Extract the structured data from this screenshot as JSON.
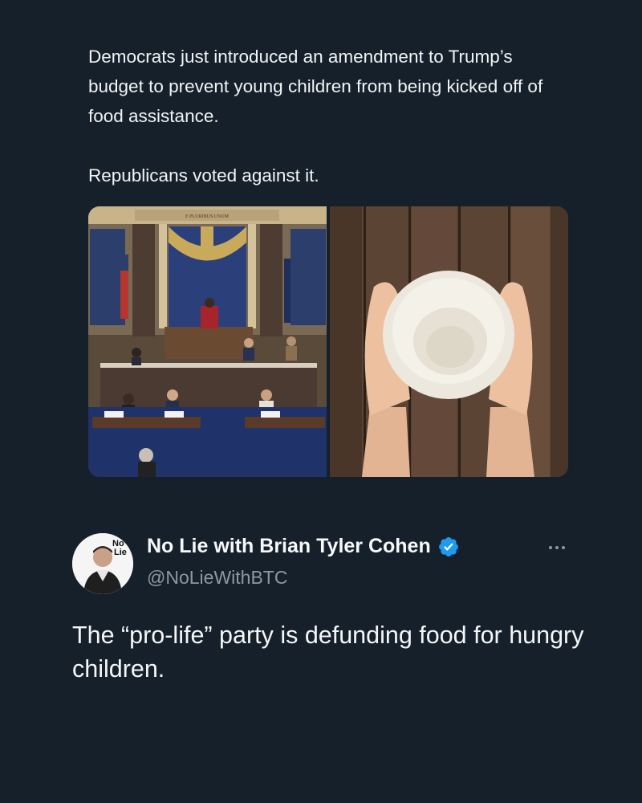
{
  "quoted": {
    "paragraph1": "Democrats just introduced an amendment to Trump’s budget to prevent young children from being kicked off of food assistance.",
    "paragraph2": "Republicans voted against it."
  },
  "media": {
    "left_banner": "E PLURIBUS UNUM"
  },
  "author": {
    "name": "No Lie with Brian Tyler Cohen",
    "handle": "@NoLieWithBTC",
    "avatar_text_1": "No",
    "avatar_text_2": "Lie"
  },
  "tweet": {
    "text": "The “pro-life” party is defunding food for hungry children."
  },
  "colors": {
    "background": "#15202b",
    "verified": "#1d9bf0",
    "secondary_text": "#8b98a5"
  },
  "icons": [
    "verified-badge-icon",
    "more-options-icon"
  ]
}
